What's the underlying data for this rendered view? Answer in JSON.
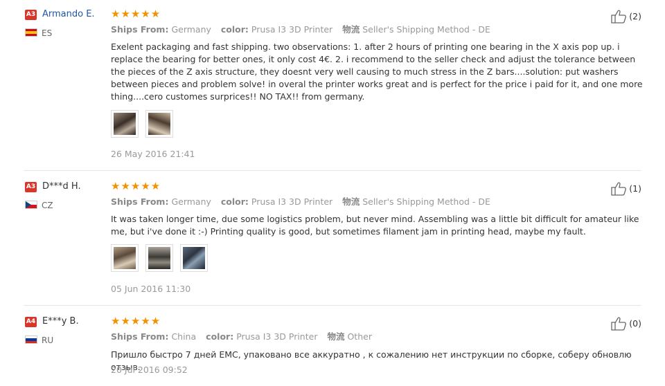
{
  "labels": {
    "ships_from": "Ships From:",
    "color": "color:",
    "logistics": "物流"
  },
  "reviews": [
    {
      "badge": "A3",
      "name": "Armando E.",
      "country": "ES",
      "rating": 5,
      "stars": "★★★★★",
      "ships_from": "Germany",
      "color": "Prusa I3 3D Printer",
      "logistics": "Seller's Shipping Method - DE",
      "text": "Exelent packaging and fast shipping. two observations: 1. after 2 hours of printing one bearing in the X axis pop up. i replace the bearing for better ones, it only cost 4€. 2. i recommend to the seller check and adjust the tolerance between the pieces of the Z axis structure, they doesnt very well causing to much stress in the Z bars....solution: put washers between pieces and problem solve! in overal the printer works great and is perfect for the price i paid for it, and one more thing....cero customes surprices!! NO TAX!! from germany.",
      "date": "26 May 2016 21:41",
      "helpful": "(2)",
      "photos": 2
    },
    {
      "badge": "A3",
      "name": "D***d H.",
      "country": "CZ",
      "rating": 5,
      "stars": "★★★★★",
      "ships_from": "Germany",
      "color": "Prusa I3 3D Printer",
      "logistics": "Seller's Shipping Method - DE",
      "text": "It was taken longer time, due some logistics problem, but never mind. Assembling was a little bit difficult for amateur like me, but i've done it :-) Printing quality is good, but sometimes filament jam in printing head, maybe my fault.",
      "date": "05 Jun 2016 11:30",
      "helpful": "(1)",
      "photos": 3
    },
    {
      "badge": "A4",
      "name": "E***y B.",
      "country": "RU",
      "rating": 5,
      "stars": "★★★★★",
      "ships_from": "China",
      "color": "Prusa I3 3D Printer",
      "logistics": "Other",
      "text": "Пришло быстро 7 дней ЕМС, упаковано все аккуратно , к сожалению нет инструкции по сборке, соберу обновлю отзыв.",
      "date": "20 Jul 2016 09:52",
      "helpful": "(0)",
      "photos": 0
    }
  ]
}
